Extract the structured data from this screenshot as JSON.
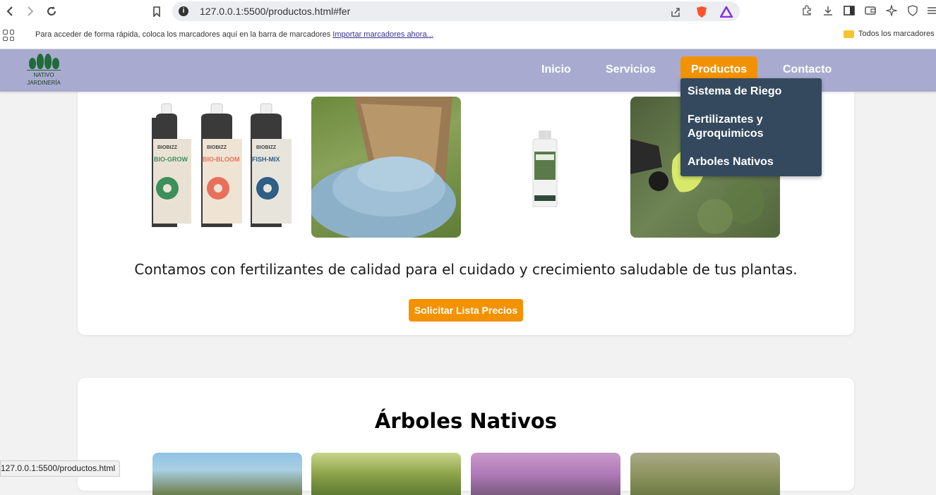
{
  "browser": {
    "url": "127.0.0.1:5500/productos.html#fer",
    "bookmarks_hint": "Para acceder de forma rápida, coloca los marcadores aquí en la barra de marcadores",
    "bookmarks_link": "Importar marcadores ahora...",
    "bookmarks_folder": "Todos los marcadores",
    "status_url": "127.0.0.1:5500/productos.html"
  },
  "site": {
    "logo_line1": "NATIVO",
    "logo_line2": "JARDINERÍA",
    "nav": {
      "inicio": "Inicio",
      "servicios": "Servicios",
      "productos": "Productos",
      "contacto": "Contacto"
    },
    "dropdown": {
      "riego": "Sistema de Riego",
      "fertilizantes": "Fertilizantes y Agroquimicos",
      "arboles": "Arboles Nativos"
    }
  },
  "fertilizantes": {
    "caption": "Contamos con fertilizantes de calidad para el cuidado y crecimiento saludable de tus plantas.",
    "button": "Solicitar Lista Precios",
    "bottle_labels": [
      "BIO-GROW",
      "BIO-BLOOM",
      "FISH-MIX"
    ],
    "bottle_brand": "BIOBIZZ"
  },
  "arboles": {
    "title": "Árboles Nativos"
  }
}
